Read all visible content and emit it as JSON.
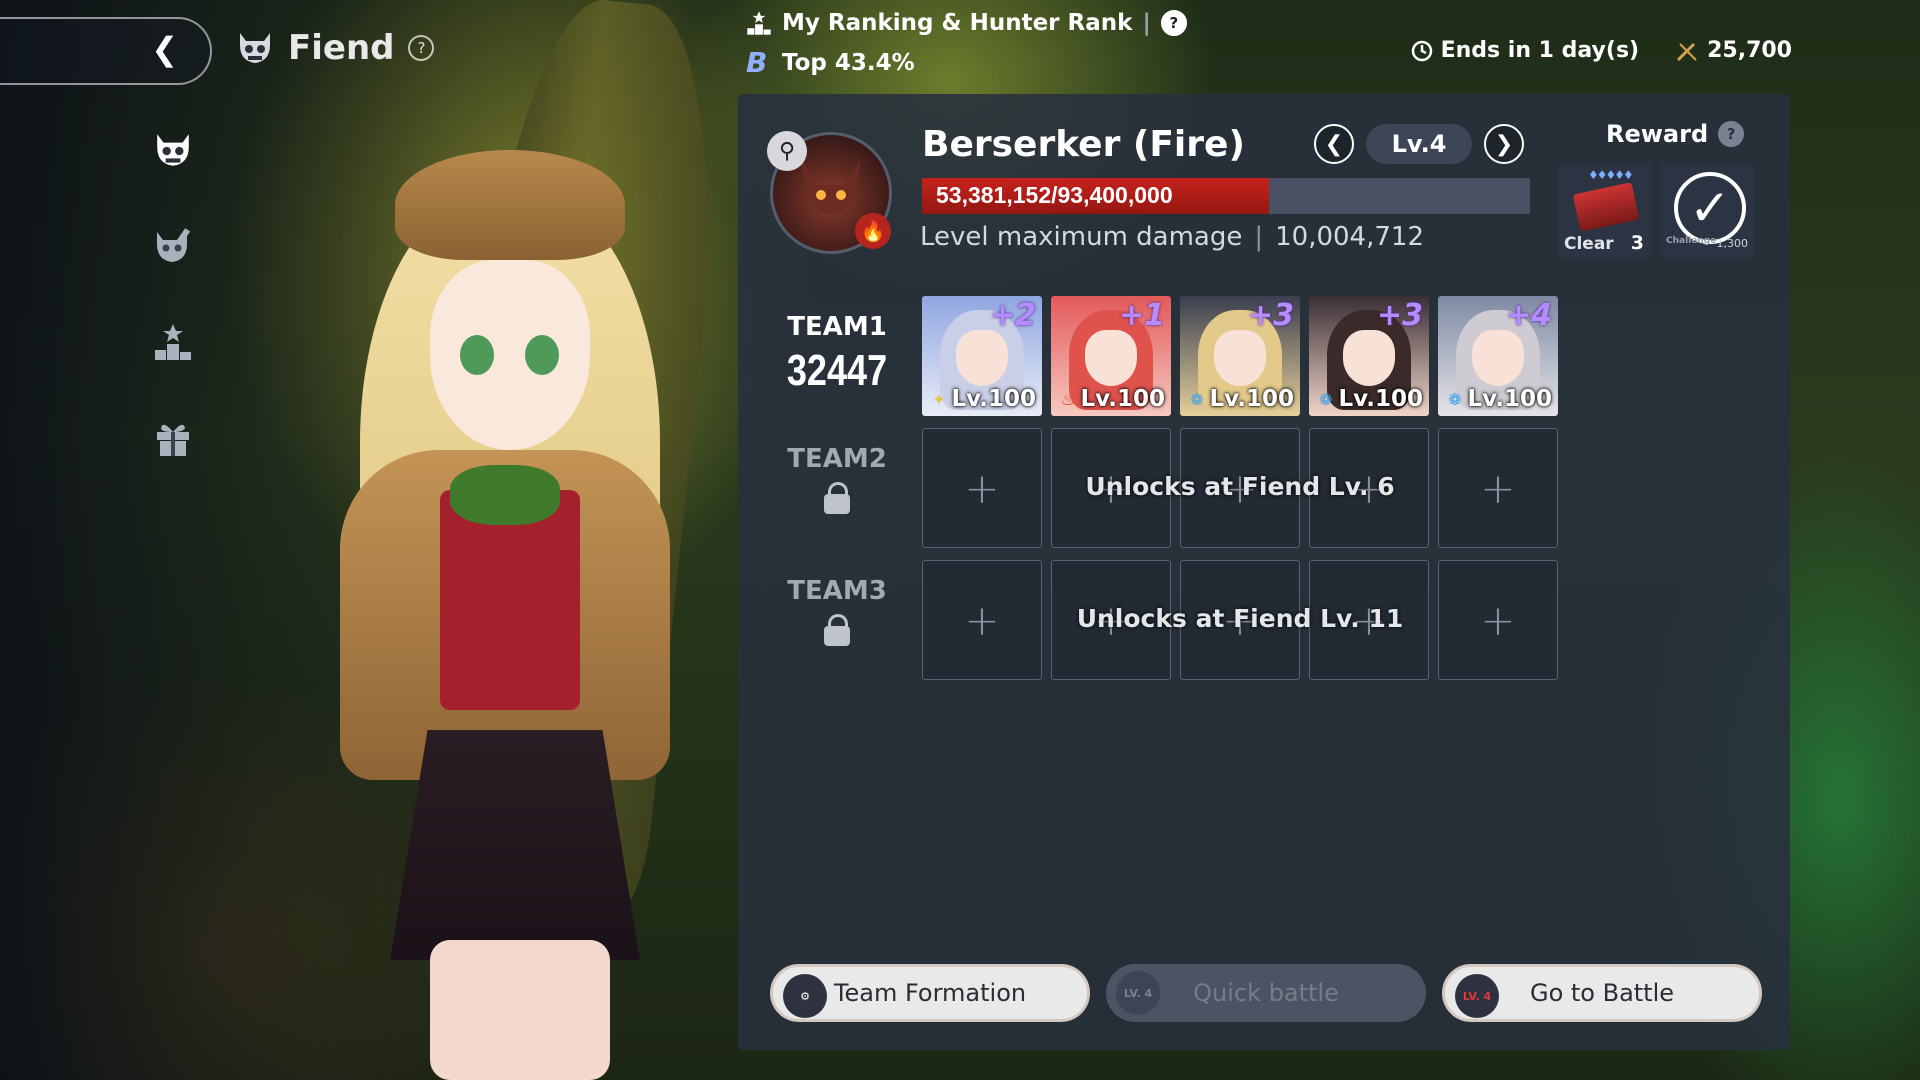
{
  "header": {
    "title": "Fiend",
    "ranking_label": "My Ranking & Hunter Rank",
    "rank_grade": "B",
    "rank_percent": "Top 43.4%",
    "ends_label": "Ends in 1 day(s)",
    "currency_value": "25,700"
  },
  "sidebar": {
    "items": [
      {
        "icon": "fiend-skull-icon",
        "active": true
      },
      {
        "icon": "fiend-battle-icon",
        "active": false
      },
      {
        "icon": "ranking-podium-icon",
        "active": false
      },
      {
        "icon": "gift-box-icon",
        "active": false
      }
    ]
  },
  "boss": {
    "name": "Berserker (Fire)",
    "level_label": "Lv.4",
    "hp_text": "53,381,152/93,400,000",
    "hp_current": 53381152,
    "hp_max": 93400000,
    "max_damage_label": "Level maximum damage",
    "max_damage_value": "10,004,712",
    "element_color": "#b5241e"
  },
  "reward": {
    "label": "Reward",
    "clear_label": "Clear",
    "clear_count": "3",
    "challenge_label": "Challenge",
    "challenge_value": "1,300"
  },
  "teams": [
    {
      "name": "TEAM1",
      "power": "32447",
      "locked": false,
      "members": [
        {
          "star": "+2",
          "level": "Lv.100",
          "element": "light",
          "color_a": "#8fa6e0",
          "color_b": "#e8ecf7",
          "hair": "#c9cfe6"
        },
        {
          "star": "+1",
          "level": "Lv.100",
          "element": "fire",
          "color_a": "#e25a5a",
          "color_b": "#f7c9c0",
          "hair": "#e0524c"
        },
        {
          "star": "+3",
          "level": "Lv.100",
          "element": "water",
          "color_a": "#3a3f4f",
          "color_b": "#e7cf9a",
          "hair": "#e3c98a"
        },
        {
          "star": "+3",
          "level": "Lv.100",
          "element": "water",
          "color_a": "#3a2f35",
          "color_b": "#f0d4c8",
          "hair": "#3a2b2a"
        },
        {
          "star": "+4",
          "level": "Lv.100",
          "element": "water",
          "color_a": "#7e8aa3",
          "color_b": "#e6e4e9",
          "hair": "#cfcbd2"
        }
      ]
    },
    {
      "name": "TEAM2",
      "locked": true,
      "unlock_text": "Unlocks at Fiend Lv. 6"
    },
    {
      "name": "TEAM3",
      "locked": true,
      "unlock_text": "Unlocks at Fiend Lv. 11"
    }
  ],
  "buttons": {
    "team_formation": "Team Formation",
    "quick_battle": "Quick battle",
    "quick_battle_badge": "LV. 4",
    "go_to_battle": "Go to Battle",
    "go_battle_badge": "LV. 4"
  }
}
